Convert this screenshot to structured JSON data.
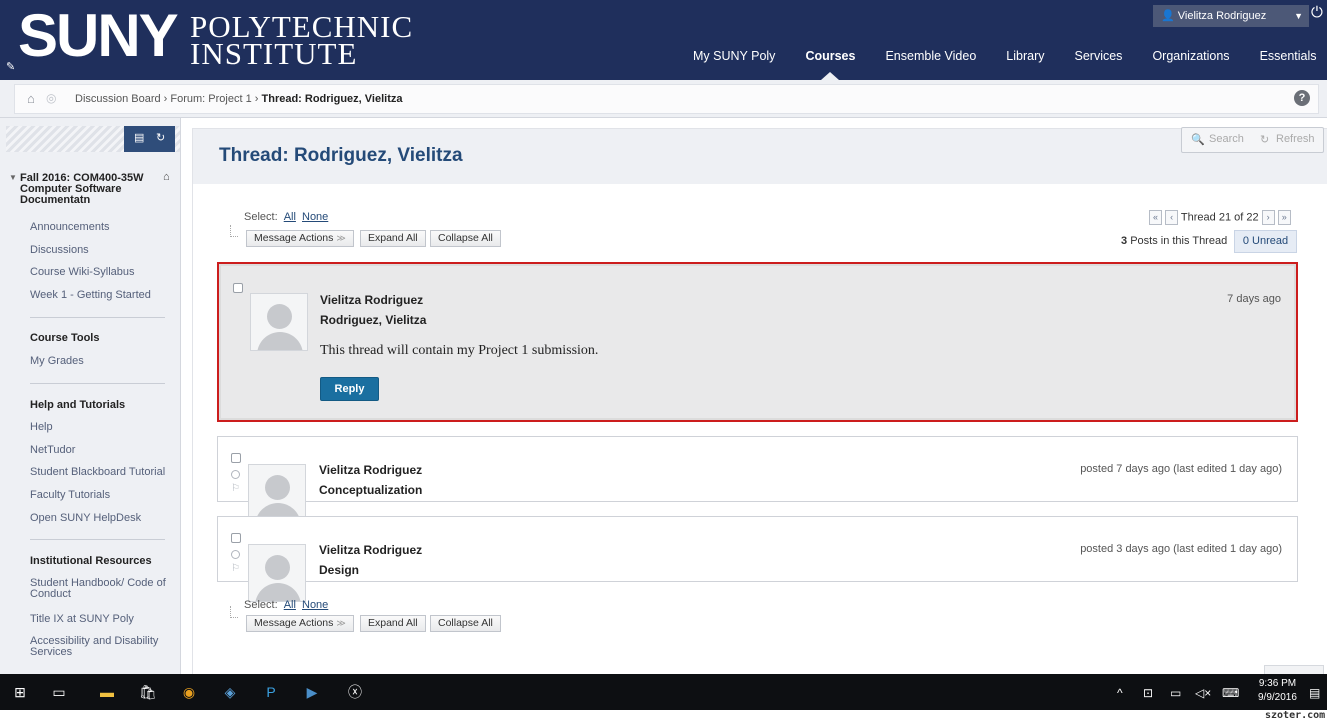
{
  "header": {
    "logo_main": "SUNY",
    "logo_line1": "POLYTECHNIC",
    "logo_line2": "INSTITUTE",
    "nav": [
      "My SUNY Poly",
      "Courses",
      "Ensemble Video",
      "Library",
      "Services",
      "Organizations",
      "Essentials"
    ],
    "active_nav": "Courses",
    "user_name": "Vielitza Rodriguez"
  },
  "breadcrumb": {
    "item1": "Discussion Board",
    "item2": "Forum: Project 1",
    "current": "Thread: Rodriguez, Vielitza"
  },
  "sidebar": {
    "course_title": "Fall 2016: COM400-35W Computer Software Documentatn",
    "links_group1": [
      "Announcements",
      "Discussions",
      "Course Wiki-Syllabus",
      "Week 1 - Getting Started"
    ],
    "course_tools_heading": "Course Tools",
    "links_group2": [
      "My Grades"
    ],
    "help_heading": "Help and Tutorials",
    "links_group3": [
      "Help",
      "NetTudor",
      "Student Blackboard Tutorial",
      "Faculty Tutorials",
      "Open SUNY HelpDesk"
    ],
    "inst_heading": "Institutional Resources",
    "links_group4": [
      "Student Handbook/ Code of Conduct",
      "Title IX at SUNY Poly",
      "Accessibility and Disability Services"
    ]
  },
  "main": {
    "title": "Thread: Rodriguez, Vielitza",
    "search_label": "Search",
    "refresh_label": "Refresh",
    "select_label": "Select:",
    "select_all": "All",
    "select_none": "None",
    "message_actions": "Message Actions",
    "expand_all": "Expand All",
    "collapse_all": "Collapse All",
    "thread_pos": "Thread 21 of 22",
    "posts_count": "3",
    "posts_label": "Posts in this Thread",
    "unread": "0 Unread"
  },
  "posts": [
    {
      "author": "Vielitza Rodriguez",
      "title": "Rodriguez, Vielitza",
      "time": "7 days ago",
      "body": "This thread will contain my Project 1 submission.",
      "reply": "Reply"
    },
    {
      "author": "Vielitza Rodriguez",
      "title": "Conceptualization",
      "time": "posted 7 days ago (last edited 1 day ago)"
    },
    {
      "author": "Vielitza Rodriguez",
      "title": "Design",
      "time": "posted 3 days ago (last edited 1 day ago)"
    }
  ],
  "taskbar": {
    "time": "9:36 PM",
    "date": "9/9/2016"
  },
  "watermark": "szoter.com",
  "colors": {
    "header_bg": "#1f2f5c",
    "title_blue": "#244a78",
    "reply_btn": "#1a6fa0",
    "highlight_border": "#cc1d1d"
  }
}
